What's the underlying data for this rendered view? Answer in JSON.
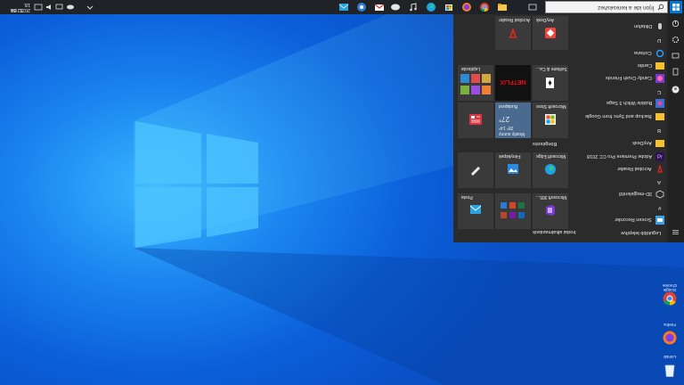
{
  "taskbar": {
    "search_text": "Írjon ide a kereséshez",
    "clock_time": "12:54",
    "clock_date": "2021. 09. 18.",
    "pinned_icons": [
      "file-explorer-icon",
      "chrome-icon",
      "edge-icon",
      "firefox-icon",
      "store-icon",
      "teams-icon",
      "gmail-icon",
      "chrome-canary-icon",
      "mail-icon"
    ],
    "accent": "#0078d7"
  },
  "start_menu": {
    "recent_header": "Legutóbb telepítve",
    "rail_icons": [
      "hamburger-icon",
      "user-icon",
      "documents-icon",
      "pictures-icon",
      "settings-icon",
      "power-icon"
    ],
    "apps": [
      {
        "label": "Screen Recorder",
        "icon": "screen-recorder-icon"
      },
      {
        "label": "#",
        "type": "letter"
      },
      {
        "label": "3D-megjelenítő",
        "icon": "3d-viewer-icon"
      },
      {
        "label": "A",
        "type": "letter"
      },
      {
        "label": "Acrobat Reader",
        "icon": "acrobat-icon"
      },
      {
        "label": "Adobe Premiere Pro CC 2018",
        "icon": "premiere-icon"
      },
      {
        "label": "AnyDesk",
        "icon": "folder-icon"
      },
      {
        "label": "B",
        "type": "letter"
      },
      {
        "label": "Backup and Sync from Google",
        "icon": "folder-icon"
      },
      {
        "label": "Bubble Witch 3 Saga",
        "icon": "bubble-witch-icon"
      },
      {
        "label": "C",
        "type": "letter"
      },
      {
        "label": "Candy Crush Friends",
        "icon": "candy-crush-icon"
      },
      {
        "label": "Cardio",
        "icon": "folder-icon"
      },
      {
        "label": "Cortana",
        "icon": "cortana-icon"
      },
      {
        "label": "D",
        "type": "letter"
      },
      {
        "label": "Diktafon",
        "icon": "dictaphone-icon"
      }
    ],
    "groups": [
      {
        "header": "Irodai alkalmazások"
      },
      {
        "header": "Böngészés"
      }
    ],
    "tiles": [
      {
        "label": "Posta",
        "color": "#2f6fbf"
      },
      {
        "label": "Microsoft 365...",
        "color": "#3a3a3a"
      },
      {
        "label": "Microsoft Edge",
        "color": "#3a3a3a"
      },
      {
        "label": "Fényképek",
        "color": "#3a3a3a"
      },
      {
        "label": "Microsoft Store",
        "color": "#3a3a3a"
      },
      {
        "label": "Budapest",
        "color": "#4a6b8f",
        "weather_top": "Mostly sunny",
        "weather_temp": "27°",
        "weather_range": "28° 14°"
      },
      {
        "label": "Solitaire & Ca...",
        "color": "#3a3a3a"
      },
      {
        "label": "NETFLIX",
        "color": "#111111"
      },
      {
        "label": "Lejátszás",
        "color": "#3a3a3a"
      },
      {
        "label": "Acrobat Reader",
        "color": "#3a3a3a"
      },
      {
        "label": "AnyDesk",
        "color": "#3a3a3a"
      }
    ]
  },
  "desktop_icons": [
    {
      "label": "Google Chrome",
      "icon": "chrome-icon"
    },
    {
      "label": "Firefox",
      "icon": "firefox-icon"
    },
    {
      "label": "Lomtár",
      "icon": "recycle-bin-icon"
    }
  ]
}
